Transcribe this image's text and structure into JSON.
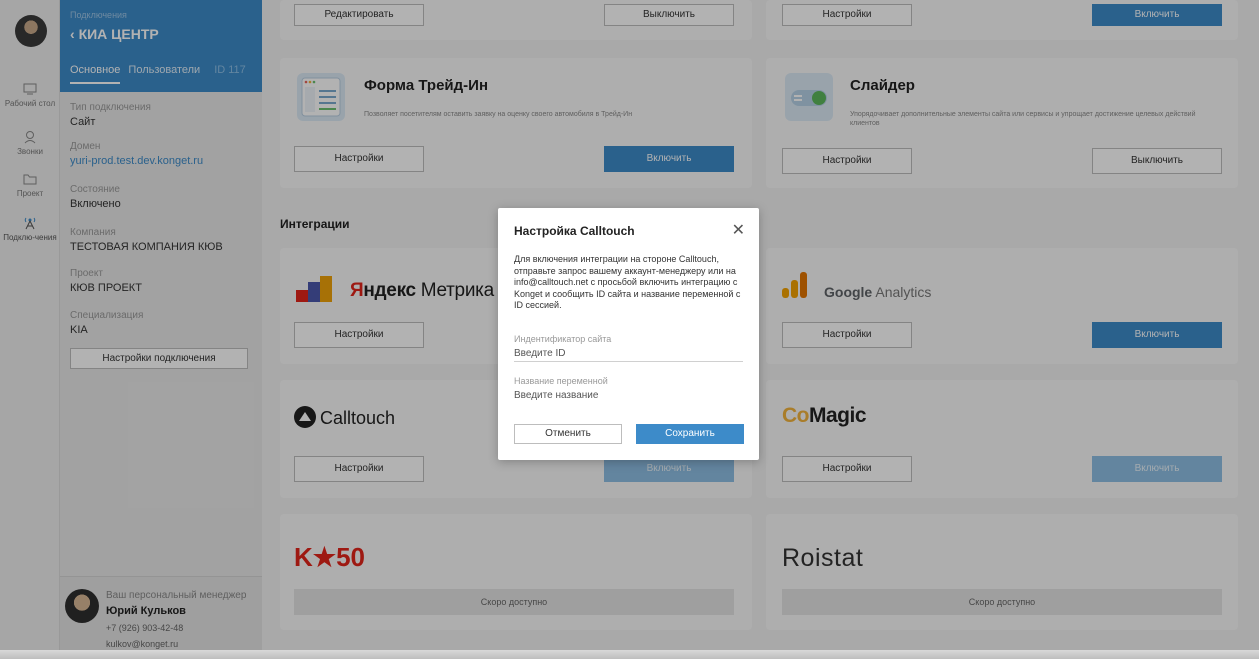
{
  "rail": {
    "items": [
      {
        "label": "Рабочий стол",
        "icon": "desktop-icon"
      },
      {
        "label": "Звонки",
        "icon": "phone-user-icon"
      },
      {
        "label": "Проект",
        "icon": "folder-icon"
      },
      {
        "label": "Подклю-чения",
        "icon": "antenna-icon"
      }
    ]
  },
  "panel": {
    "subtitle": "Подключения",
    "title": "КИА ЦЕНТР",
    "tabs": [
      "Основное",
      "Пользователи"
    ],
    "id_label": "ID 117",
    "fields": [
      {
        "label": "Тип подключения",
        "value": "Сайт"
      },
      {
        "label": "Домен",
        "value": "yuri-prod.test.dev.konget.ru"
      },
      {
        "label": "Состояние",
        "value": "Включено"
      },
      {
        "label": "Компания",
        "value": "ТЕСТОВАЯ КОМПАНИЯ КЮВ"
      },
      {
        "label": "Проект",
        "value": "КЮВ ПРОЕКТ"
      },
      {
        "label": "Специализация",
        "value": "KIA"
      }
    ],
    "settings_button": "Настройки подключения",
    "manager": {
      "title": "Ваш персональный менеджер",
      "name": "Юрий Кульков",
      "phone": "+7 (926) 903-42-48",
      "email": "kulkov@konget.ru"
    }
  },
  "main": {
    "top_row": {
      "left_edit": "Редактировать",
      "left_off": "Выключить",
      "right_settings": "Настройки",
      "right_on": "Включить"
    },
    "tradein": {
      "title": "Форма Трейд-Ин",
      "desc": "Позволяет посетителям оставить заявку на оценку своего автомобиля в Трейд-Ин",
      "settings": "Настройки",
      "toggle": "Включить"
    },
    "slider": {
      "title": "Слайдер",
      "desc": "Упорядочивает дополнительные элементы сайта или сервисы и упрощает достижение целевых действий клиентов",
      "settings": "Настройки",
      "toggle": "Выключить"
    },
    "section_title": "Интеграции",
    "yandex": {
      "brand_red": "Я",
      "brand_rest": "ндекс",
      "brand_tail": " Метрика",
      "settings": "Настройки"
    },
    "google": {
      "brand_bold": "Google",
      "brand_rest": " Analytics",
      "settings": "Настройки",
      "toggle": "Включить"
    },
    "calltouch": {
      "brand": "Calltouch",
      "settings": "Настройки",
      "toggle": "Включить"
    },
    "comagic": {
      "brand_co": "Co",
      "brand_magic": "Magic",
      "settings": "Настройки",
      "toggle": "Включить"
    },
    "k50": {
      "brand": "K★50",
      "soon": "Скоро доступно"
    },
    "roistat": {
      "brand": "Roistat",
      "soon": "Скоро доступно"
    }
  },
  "modal": {
    "title": "Настройка Calltouch",
    "text": "Для включения интеграции на стороне Calltouch, отправьте запрос вашему аккаунт-менеджеру или на info@calltouch.net с просьбой включить интеграцию с Konget и сообщить ID сайта и название переменной с ID сессией.",
    "site_id_label": "Индентификатор сайта",
    "site_id_placeholder": "Введите ID",
    "var_label": "Название переменной",
    "var_placeholder": "Введите название",
    "cancel": "Отменить",
    "save": "Сохранить"
  },
  "colors": {
    "accent": "#3d8bc9",
    "k50_red": "#e3241b",
    "google_orange": "#f4a300"
  }
}
